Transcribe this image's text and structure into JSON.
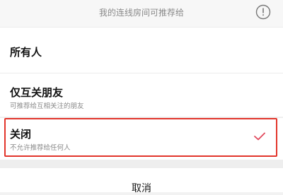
{
  "header": {
    "title": "我的连线房间可推荐给",
    "info_icon": "info-circle-icon"
  },
  "options": [
    {
      "label": "所有人",
      "description": "",
      "selected": false
    },
    {
      "label": "仅互关朋友",
      "description": "可推荐给互相关注的朋友",
      "selected": false
    },
    {
      "label": "关闭",
      "description": "不允许推荐给任何人",
      "selected": true
    }
  ],
  "selected_indicator": "checkmark-icon",
  "colors": {
    "accent": "#e2352b",
    "check": "#e0475b"
  },
  "cancel_label": "取消"
}
